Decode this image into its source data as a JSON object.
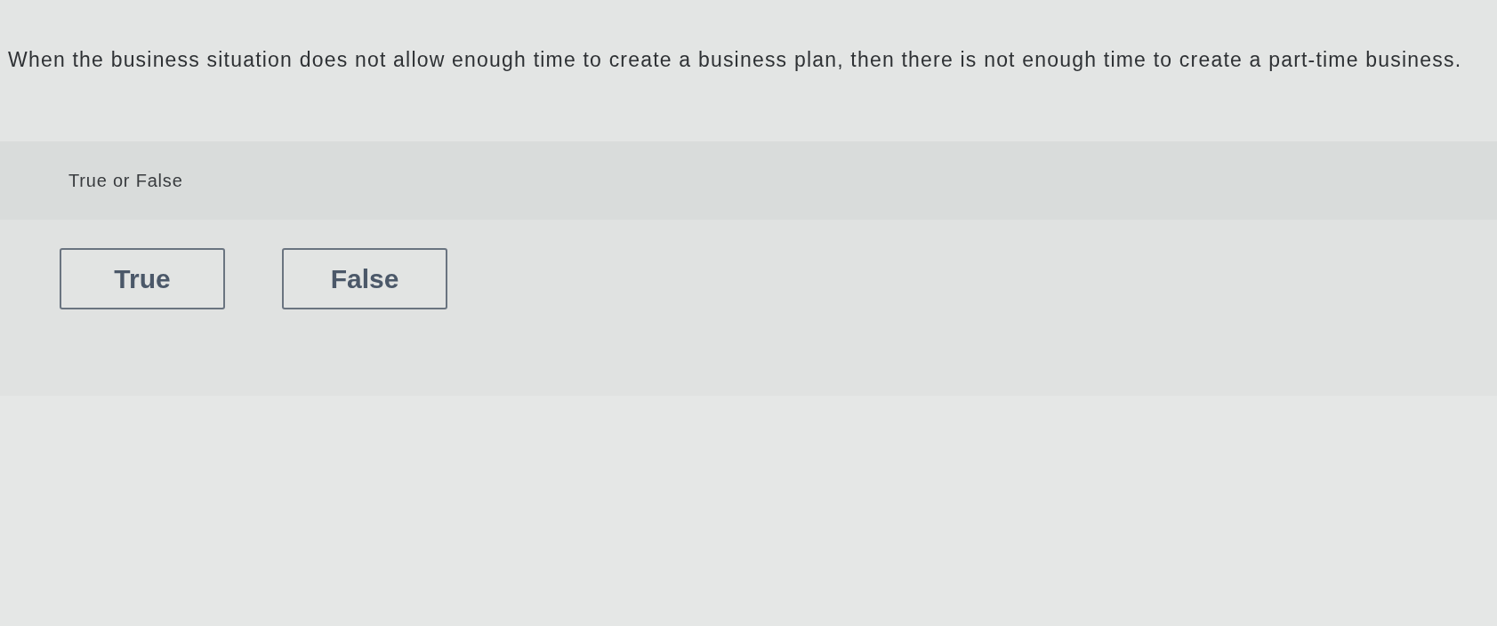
{
  "question": {
    "text": "When the business situation does not allow enough time to create a business plan, then there is not enough time to create a part-time business."
  },
  "prompt": {
    "text": "True or False"
  },
  "choices": [
    {
      "label": "True",
      "selected": false
    },
    {
      "label": "False",
      "selected": false
    }
  ]
}
